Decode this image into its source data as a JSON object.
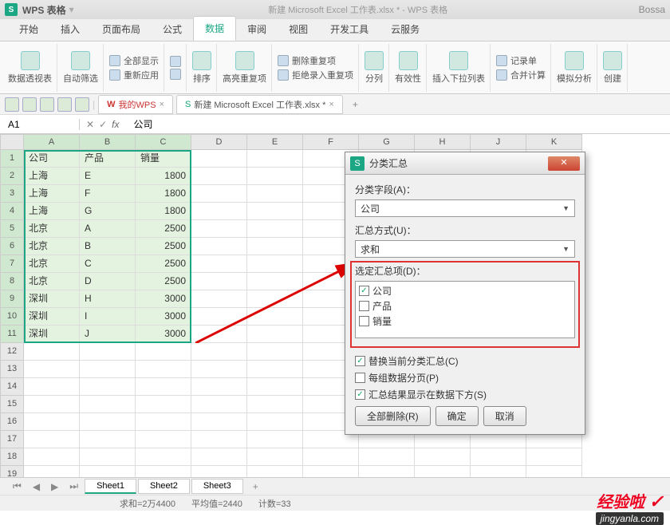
{
  "titlebar": {
    "app": "WPS 表格",
    "doc": "新建 Microsoft Excel 工作表.xlsx * - WPS 表格",
    "user": "Bossa"
  },
  "menus": [
    "开始",
    "插入",
    "页面布局",
    "公式",
    "数据",
    "审阅",
    "视图",
    "开发工具",
    "云服务"
  ],
  "menu_active": 4,
  "ribbon": {
    "pivot": "数据透视表",
    "autofilter": "自动筛选",
    "showall": "全部显示",
    "reapply": "重新应用",
    "sort": "排序",
    "highlight": "高亮重复项",
    "deldup": "删除重复项",
    "rejectdup": "拒绝录入重复项",
    "split": "分列",
    "validity": "有效性",
    "dropdown": "插入下拉列表",
    "record": "记录单",
    "consolidate": "合并计算",
    "whatif": "模拟分析",
    "create": "创建"
  },
  "qat_tabs": [
    {
      "label": "我的WPS",
      "closable": true
    },
    {
      "label": "新建 Microsoft Excel 工作表.xlsx *",
      "closable": true
    }
  ],
  "fx": {
    "cell": "A1",
    "value": "公司",
    "fxlabel": "fx"
  },
  "cols": [
    "A",
    "B",
    "C",
    "D",
    "E",
    "F",
    "G",
    "H",
    "J",
    "K"
  ],
  "data_rows": [
    [
      "公司",
      "产品",
      "销量"
    ],
    [
      "上海",
      "E",
      "1800"
    ],
    [
      "上海",
      "F",
      "1800"
    ],
    [
      "上海",
      "G",
      "1800"
    ],
    [
      "北京",
      "A",
      "2500"
    ],
    [
      "北京",
      "B",
      "2500"
    ],
    [
      "北京",
      "C",
      "2500"
    ],
    [
      "北京",
      "D",
      "2500"
    ],
    [
      "深圳",
      "H",
      "3000"
    ],
    [
      "深圳",
      "I",
      "3000"
    ],
    [
      "深圳",
      "J",
      "3000"
    ]
  ],
  "total_rows": 19,
  "dialog": {
    "title": "分类汇总",
    "field_label": "分类字段(A)：",
    "field_value": "公司",
    "method_label": "汇总方式(U)：",
    "method_value": "求和",
    "items_label": "选定汇总项(D)：",
    "items": [
      {
        "label": "公司",
        "checked": true
      },
      {
        "label": "产品",
        "checked": false
      },
      {
        "label": "销量",
        "checked": false
      }
    ],
    "opts": [
      {
        "label": "替换当前分类汇总(C)",
        "checked": true
      },
      {
        "label": "每组数据分页(P)",
        "checked": false
      },
      {
        "label": "汇总结果显示在数据下方(S)",
        "checked": true
      }
    ],
    "btn_deleteall": "全部删除(R)",
    "btn_ok": "确定",
    "btn_cancel": "取消"
  },
  "sheets": [
    "Sheet1",
    "Sheet2",
    "Sheet3"
  ],
  "sheet_active": 0,
  "status": {
    "sum": "求和=2万4400",
    "avg": "平均值=2440",
    "count": "计数=33"
  },
  "watermark": {
    "line1": "经验啦",
    "check": "✓",
    "line2": "jingyanla.com"
  }
}
